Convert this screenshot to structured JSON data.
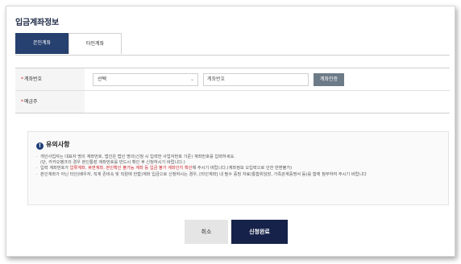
{
  "header": {
    "title": "입금계좌정보"
  },
  "tabs": [
    {
      "label": "본인계좌"
    },
    {
      "label": "타인계좌"
    }
  ],
  "form": {
    "account_number": {
      "label": "계좌번호",
      "bank_select": {
        "value": "선택"
      },
      "account_input": {
        "placeholder": "계좌번호"
      },
      "verify_label": "계좌인증"
    },
    "holder": {
      "label": "예금주"
    }
  },
  "notice": {
    "title": "유의사항",
    "item1": "개인사업자는 대표자 명의 계좌번호, 법인은 법인 명의(신청 시 입력한 사업자번호 기준) 계좌번호를 입력하세요.",
    "item1b": "(단, 카카오뱅크의 경우 본인통장 계좌번호를 반드시 확인 후 신청하시기 바랍니다.)",
    "item2_prefix": "입력 계좌번호가 ",
    "item2_red": "압류계좌, 휴면계좌, 본인확인 불가능 계좌 등 입금 불가 계좌인지 확인",
    "item2_suffix": "해 주시기 바랍니다.(계좌정보 오입력으로 인한 반환불가)",
    "item3": "본인계좌가 아닌 타인(배우자, 직계 존비속 및 직원에 한함)계좌 입금으로 신청하시는 경우, [타인계좌] 내 필수 증빙 자료(통합위임장, 가족관계증명서 등)를 함께 첨부하여 주시기 바랍니다"
  },
  "actions": {
    "cancel_label": "취소",
    "submit_label": "신청완료"
  },
  "colors": {
    "primary": "#26406f",
    "submit": "#16224a",
    "required": "#d0282e"
  }
}
